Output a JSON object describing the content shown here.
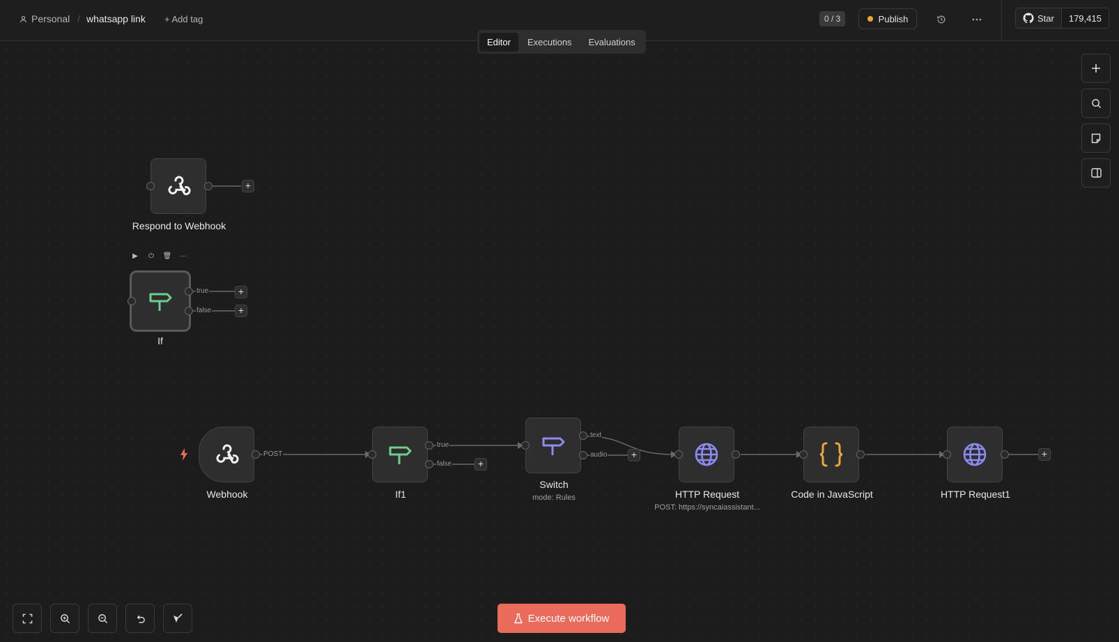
{
  "header": {
    "project": "Personal",
    "separator": "/",
    "workflow_name": "whatsapp link",
    "add_tag": "+ Add tag",
    "progress": "0 / 3",
    "publish": "Publish",
    "github_star": "Star",
    "github_count": "179,415"
  },
  "tabs": [
    "Editor",
    "Executions",
    "Evaluations"
  ],
  "active_tab": "Editor",
  "nodes": {
    "respond": {
      "label": "Respond to Webhook",
      "icon": "webhook-icon"
    },
    "if": {
      "label": "If",
      "icon": "signpost-icon",
      "true": "true",
      "false": "false"
    },
    "webhook": {
      "label": "Webhook",
      "port": "POST",
      "icon": "webhook-icon"
    },
    "if1": {
      "label": "If1",
      "true": "true",
      "false": "false",
      "icon": "signpost-icon"
    },
    "switch": {
      "label": "Switch",
      "sub": "mode: Rules",
      "text": "text",
      "audio": "audio",
      "icon": "signpost-icon"
    },
    "http": {
      "label": "HTTP Request",
      "sub": "POST: https://syncaiassistant...",
      "icon": "globe-icon"
    },
    "code": {
      "label": "Code in JavaScript",
      "icon": "braces-icon"
    },
    "http1": {
      "label": "HTTP Request1",
      "icon": "globe-icon"
    }
  },
  "execute_button": "Execute workflow",
  "colors": {
    "accent": "#ea6b5c",
    "if_green": "#6dcf8b",
    "switch_purple": "#8c8cf0",
    "code_orange": "#f0a53a"
  }
}
